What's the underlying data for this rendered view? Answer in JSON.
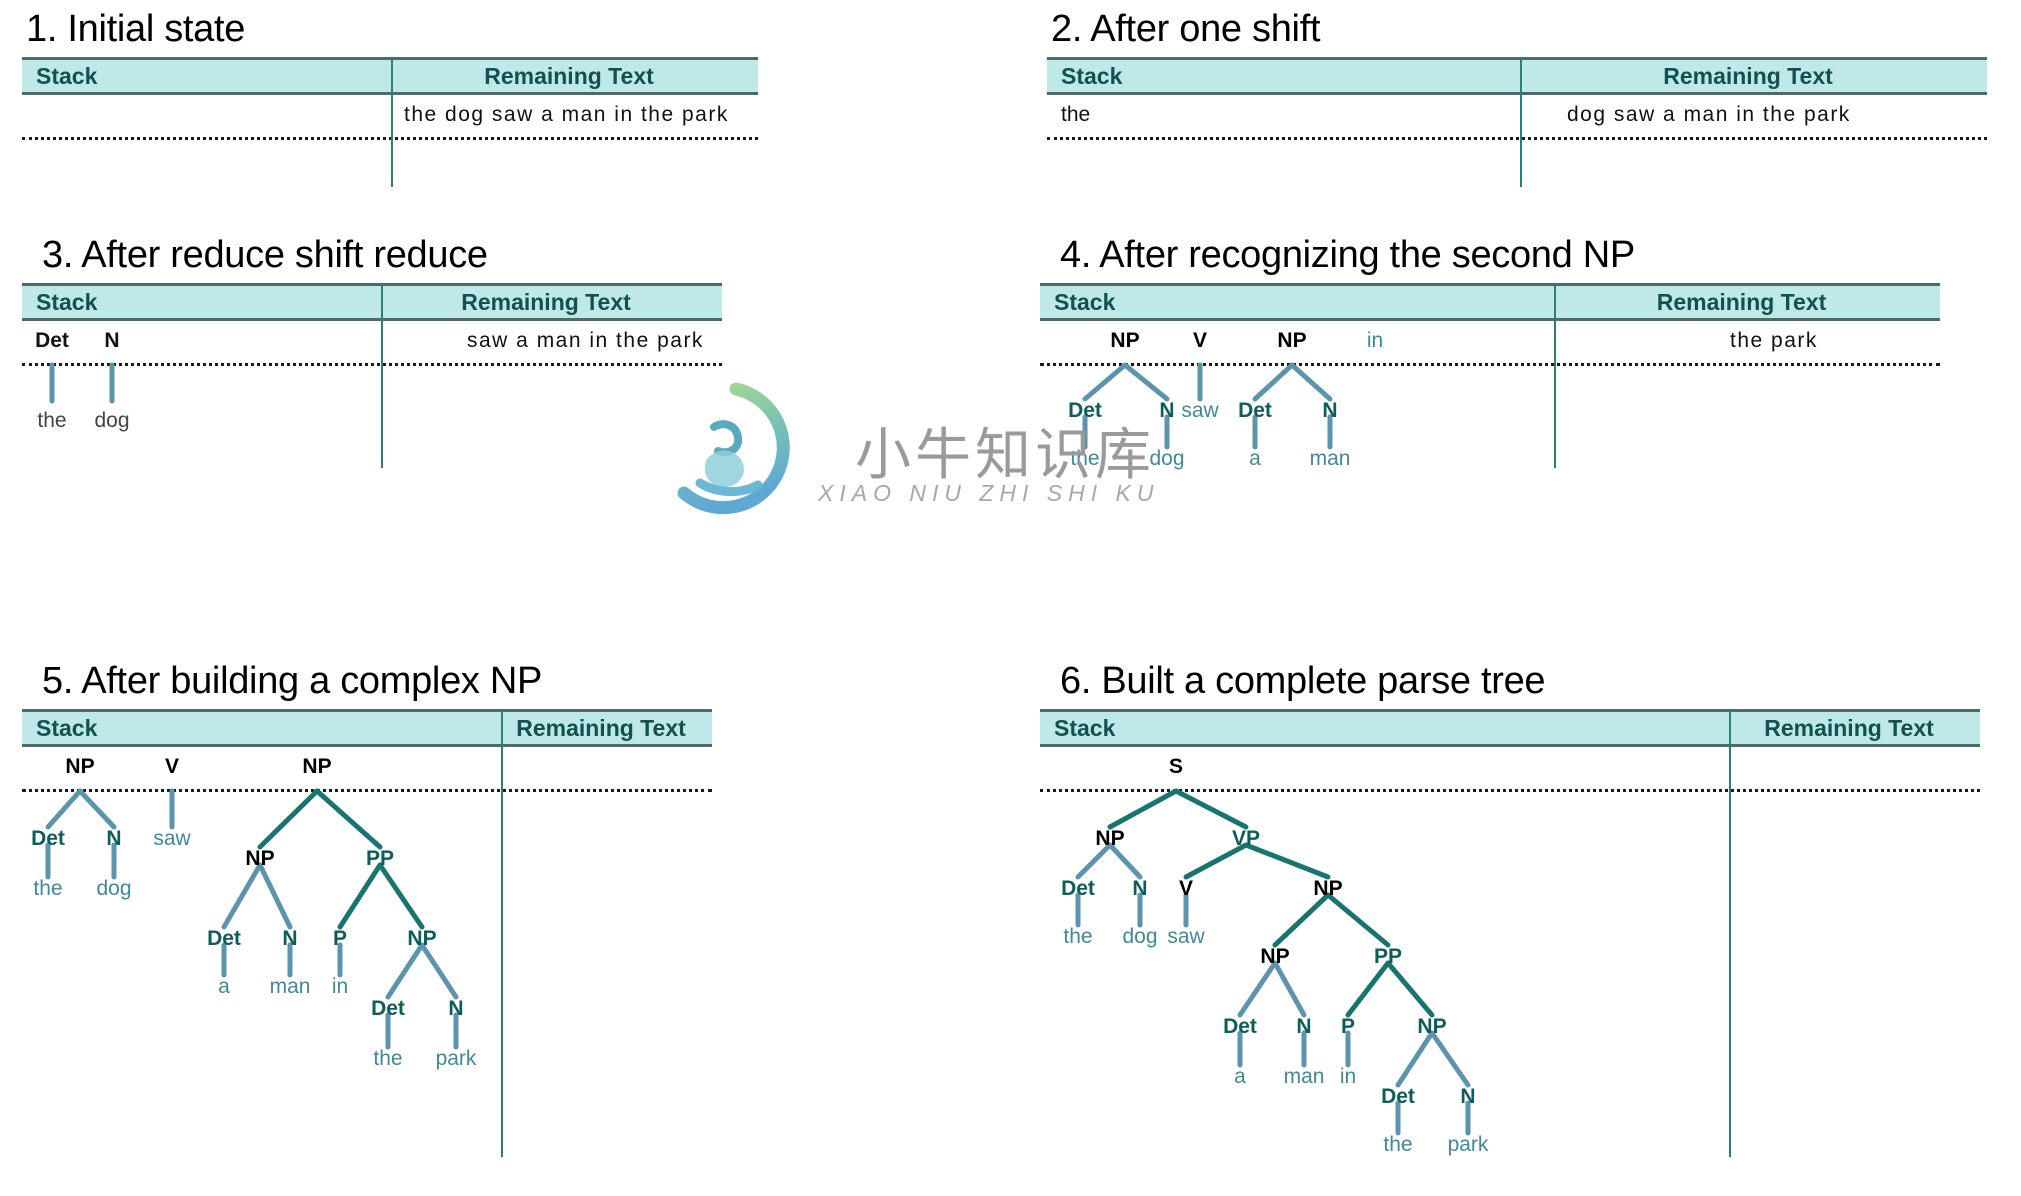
{
  "table": {
    "col_stack": "Stack",
    "col_remaining": "Remaining Text"
  },
  "watermark": {
    "chinese": "小牛知识库",
    "pinyin": "XIAO NIU ZHI SHI KU"
  },
  "colors": {
    "header_bg": "#bfe9e8",
    "header_text": "#12514f",
    "rule": "#4d6b6b",
    "divider": "#2e7d78",
    "edge_dark": "#17756e",
    "edge_blue": "#5c93ad",
    "leaf_text": "#3e8a96",
    "inner_node": "#0d5e5a",
    "root_node": "#000000"
  },
  "panels": [
    {
      "title": "1. Initial state",
      "remaining": "the dog saw a man in the park",
      "stack_text": "",
      "nodes": [],
      "leaves": []
    },
    {
      "title": "2. After one shift",
      "remaining": "dog saw a man in the park",
      "stack_text": "the",
      "nodes": [],
      "leaves": []
    },
    {
      "title": "3. After reduce shift reduce",
      "remaining": "saw a man in the park",
      "stack_text": "",
      "nodes": [
        "Det",
        "N"
      ],
      "leaves": [
        "the",
        "dog"
      ]
    },
    {
      "title": "4. After recognizing the second NP",
      "remaining": "the park",
      "stack_text": "",
      "nodes": [
        "NP",
        "V",
        "NP",
        "in",
        "Det",
        "N",
        "Det",
        "N"
      ],
      "leaves": [
        "the",
        "dog",
        "saw",
        "a",
        "man"
      ]
    },
    {
      "title": "5. After building a complex NP",
      "remaining": "",
      "stack_text": "",
      "nodes": [
        "NP",
        "V",
        "NP",
        "Det",
        "N",
        "NP",
        "PP",
        "Det",
        "N",
        "P",
        "NP",
        "Det",
        "N"
      ],
      "leaves": [
        "the",
        "dog",
        "saw",
        "a",
        "man",
        "in",
        "the",
        "park"
      ]
    },
    {
      "title": "6. Built a complete parse tree",
      "remaining": "",
      "stack_text": "",
      "nodes": [
        "S",
        "NP",
        "VP",
        "Det",
        "N",
        "V",
        "NP",
        "NP",
        "PP",
        "Det",
        "N",
        "P",
        "NP",
        "Det",
        "N"
      ],
      "leaves": [
        "the",
        "dog",
        "saw",
        "a",
        "man",
        "in",
        "the",
        "park"
      ]
    }
  ]
}
